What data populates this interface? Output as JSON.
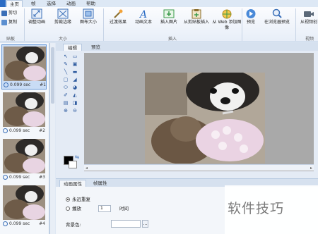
{
  "ribbon_tabs": [
    "主页",
    "帧",
    "选择",
    "动画",
    "帮助"
  ],
  "clipboard": {
    "cut": "剪切",
    "copy": "复制",
    "group": "贴板"
  },
  "size_group": {
    "label": "大小",
    "buttons": [
      "调整动画",
      "剪裁边缘",
      "图布大小"
    ]
  },
  "insert_group": {
    "label": "插入",
    "buttons": [
      "过渡效果",
      "动画文本",
      "插入图片",
      "从剪贴板插入",
      "从 Web 添加图像"
    ]
  },
  "preview_buttons": [
    "预览",
    "在浏览器预览"
  ],
  "video_group": {
    "button": "从视频创",
    "label": "视频"
  },
  "frames": [
    {
      "duration": "0.099 sec",
      "number": "#1"
    },
    {
      "duration": "0.099 sec",
      "number": "#2"
    },
    {
      "duration": "0.099 sec",
      "number": "#3"
    },
    {
      "duration": "0.099 sec",
      "number": "#4"
    }
  ],
  "editor_tabs": [
    "编辑",
    "预览"
  ],
  "tools": [
    "↖",
    "▭",
    "✎",
    "▣",
    "╲",
    "▬",
    "▢",
    "◢",
    "⬭",
    "◕",
    "✐",
    "◭",
    "▤",
    "◨",
    "⊕",
    "⊖"
  ],
  "colors": {
    "foreground": "#000000",
    "background": "#ffffff",
    "ribbon_accent": "#2b6cc4"
  },
  "props_tabs": [
    "动画属性",
    "帧属性"
  ],
  "props": {
    "loop_forever": "永远重复",
    "play": "播放",
    "play_count": "1",
    "times": "时间",
    "bg_color_label": "背景色:",
    "browse": "..."
  },
  "watermark": "软件技巧"
}
